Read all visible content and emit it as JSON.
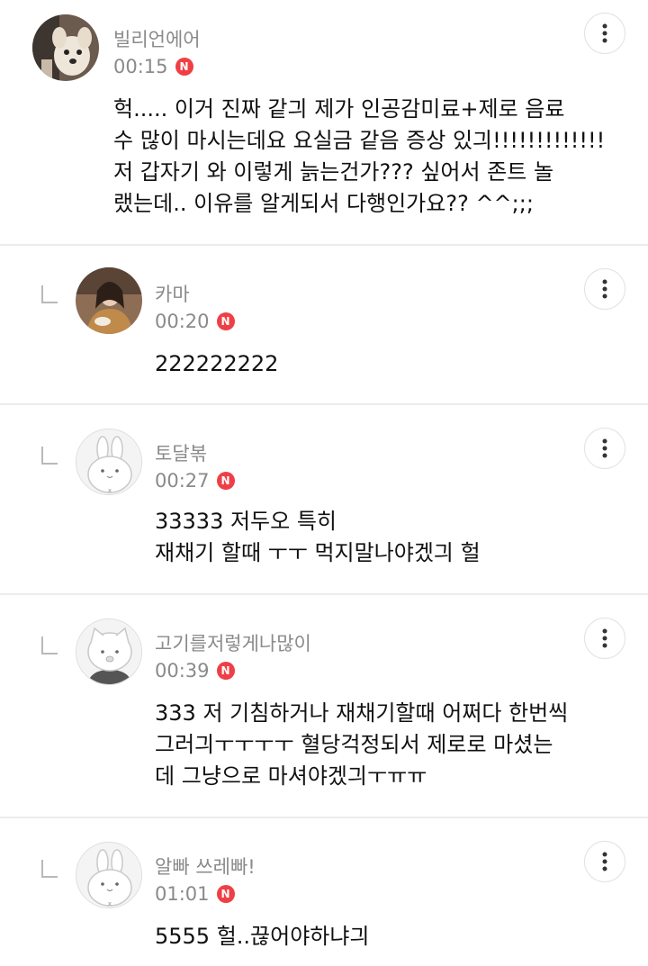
{
  "comments": [
    {
      "author": "빌리언에어",
      "time": "00:15",
      "badge": "N",
      "avatar": "dog-photo",
      "text": "헉..... 이거 진짜 같긔 제가 인공감미료+제로 음료\n수 많이 마시는데요 요실금 같음 증상 있긔!!!!!!!!!!!!!\n저 갑자기 와 이렇게 늙는건가??? 싶어서 존트 놀\n랬는데.. 이유를 알게되서 다행인가요?? ^^;;;"
    },
    {
      "author": "카마",
      "time": "00:20",
      "badge": "N",
      "avatar": "woman-photo",
      "text": "222222222"
    },
    {
      "author": "토달볶",
      "time": "00:27",
      "badge": "N",
      "avatar": "rabbit-default",
      "text": "33333 저두오 특히\n재채기 할때 ㅜㅜ 먹지말나야겠긔 헐"
    },
    {
      "author": "고기를저렇게나많이",
      "time": "00:39",
      "badge": "N",
      "avatar": "cat-default",
      "text": "333 저 기침하거나 재채기할때 어쩌다 한번씩\n그러긔ㅜㅜㅜㅜ 혈당걱정되서 제로로 마셨는\n데 그냥으로 마셔야겠긔ㅜㅠㅠ"
    },
    {
      "author": "알빠 쓰레빠!",
      "time": "01:01",
      "badge": "N",
      "avatar": "rabbit-default",
      "text": "5555 헐..끊어야하냐긔"
    }
  ],
  "icons": {
    "more": "more-vertical-icon",
    "reply": "reply-indent-icon",
    "new": "new-badge"
  },
  "colors": {
    "badge": "#ef3f46",
    "meta_text": "#8a8a8a",
    "body_text": "#111111",
    "divider": "#ececec"
  }
}
